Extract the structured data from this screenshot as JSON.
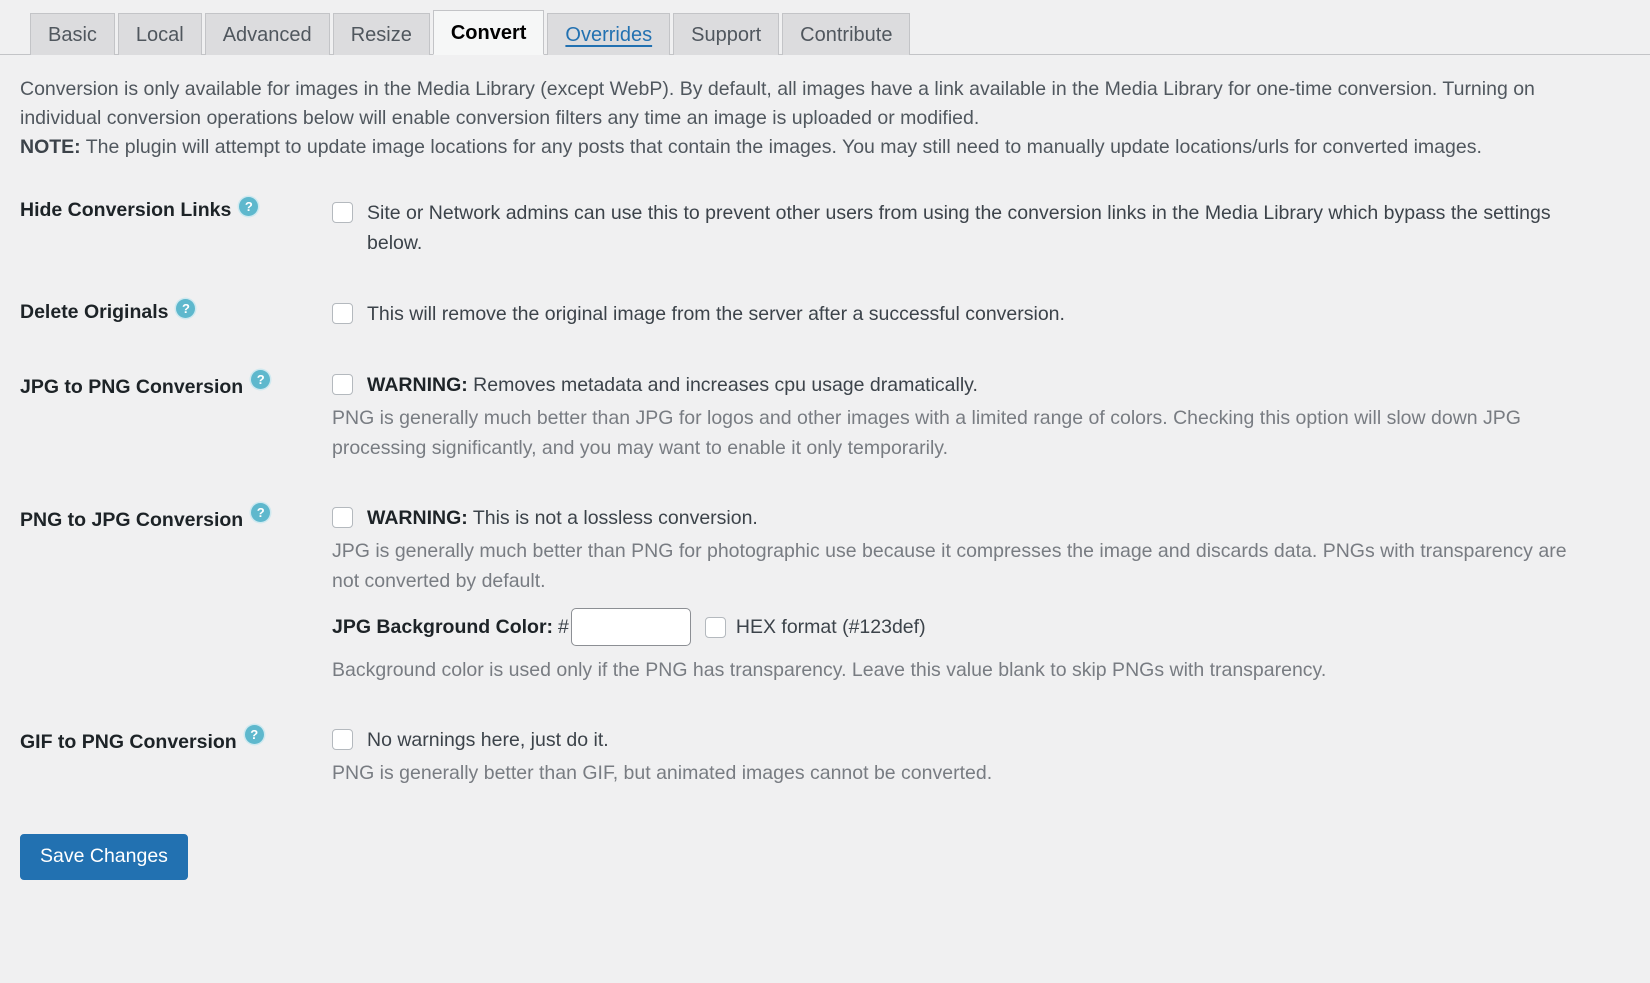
{
  "tabs": [
    {
      "label": "Basic",
      "active": false,
      "link": false
    },
    {
      "label": "Local",
      "active": false,
      "link": false
    },
    {
      "label": "Advanced",
      "active": false,
      "link": false
    },
    {
      "label": "Resize",
      "active": false,
      "link": false
    },
    {
      "label": "Convert",
      "active": true,
      "link": false
    },
    {
      "label": "Overrides",
      "active": false,
      "link": true
    },
    {
      "label": "Support",
      "active": false,
      "link": false
    },
    {
      "label": "Contribute",
      "active": false,
      "link": false
    }
  ],
  "intro": {
    "paragraph": "Conversion is only available for images in the Media Library (except WebP). By default, all images have a link available in the Media Library for one-time conversion. Turning on individual conversion operations below will enable conversion filters any time an image is uploaded or modified.",
    "note_label": "NOTE:",
    "note_text": " The plugin will attempt to update image locations for any posts that contain the images. You may still need to manually update locations/urls for converted images."
  },
  "help_icon": "?",
  "settings": {
    "hide_conversion_links": {
      "label": "Hide Conversion Links",
      "checkbox_text": "Site or Network admins can use this to prevent other users from using the conversion links in the Media Library which bypass the settings below.",
      "checked": false
    },
    "delete_originals": {
      "label": "Delete Originals",
      "checkbox_text": "This will remove the original image from the server after a successful conversion.",
      "checked": false
    },
    "jpg_to_png": {
      "label": "JPG to PNG Conversion",
      "warning_label": "WARNING:",
      "warning_text": " Removes metadata and increases cpu usage dramatically.",
      "description": "PNG is generally much better than JPG for logos and other images with a limited range of colors. Checking this option will slow down JPG processing significantly, and you may want to enable it only temporarily.",
      "checked": false
    },
    "png_to_jpg": {
      "label": "PNG to JPG Conversion",
      "warning_label": "WARNING:",
      "warning_text": " This is not a lossless conversion.",
      "description": "JPG is generally much better than PNG for photographic use because it compresses the image and discards data. PNGs with transparency are not converted by default.",
      "checked": false,
      "bg_color_label": "JPG Background Color:",
      "hash_symbol": "#",
      "bg_color_value": "",
      "bg_color_placeholder": "",
      "hex_format_label": "HEX format (#123def)",
      "hex_format_checked": false,
      "bg_color_help": "Background color is used only if the PNG has transparency. Leave this value blank to skip PNGs with transparency."
    },
    "gif_to_png": {
      "label": "GIF to PNG Conversion",
      "checkbox_text": "No warnings here, just do it.",
      "description": "PNG is generally better than GIF, but animated images cannot be converted.",
      "checked": false
    }
  },
  "save": {
    "label": "Save Changes"
  },
  "colors": {
    "page_bg": "#f0f0f1",
    "tab_inactive_bg": "#dcdcde",
    "tab_active_bg": "#f6f7f7",
    "link_blue": "#2271b1",
    "help_icon_bg": "#5eb8cd",
    "muted_text": "#787c82",
    "primary_button": "#2271b1"
  }
}
